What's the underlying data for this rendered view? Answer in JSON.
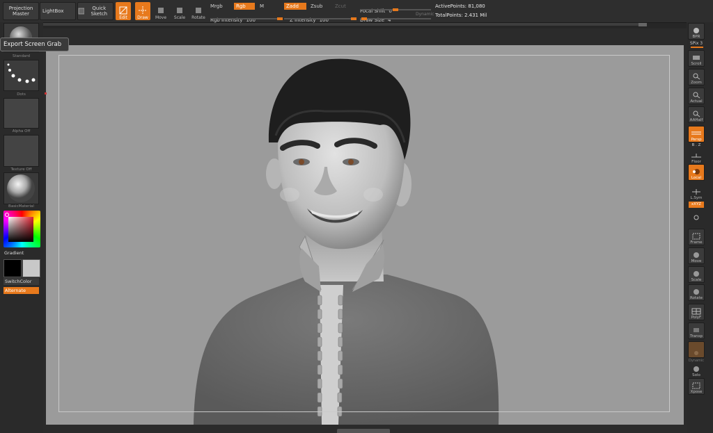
{
  "toolbar": {
    "projection_master": "Projection Master",
    "lightbox": "LightBox",
    "quick_sketch": "Quick Sketch",
    "tools": [
      {
        "label": "Edit",
        "icon": "edit-icon",
        "active": true
      },
      {
        "label": "Draw",
        "icon": "draw-icon",
        "active": true
      },
      {
        "label": "Move",
        "icon": "move-icon",
        "active": false
      },
      {
        "label": "Scale",
        "icon": "scale-icon",
        "active": false
      },
      {
        "label": "Rotate",
        "icon": "rotate-icon",
        "active": false
      }
    ],
    "mrgb": "Mrgb",
    "rgb": "Rgb",
    "m": "M",
    "rgb_intensity_label": "Rgb Intensity",
    "rgb_intensity_value": "100",
    "zadd": "Zadd",
    "zsub": "Zsub",
    "zcut": "Zcut",
    "z_intensity_label": "Z Intensity",
    "z_intensity_value": "100",
    "focal_shift_label": "Focal Shift",
    "focal_shift_value": "0",
    "draw_size_label": "Draw Size",
    "draw_size_value": "4",
    "dynamic": "Dynamic",
    "active_points": "ActivePoints: 81,080",
    "total_points": "TotalPoints: 2.431 Mil"
  },
  "tooltip": "Export Screen Grab",
  "left_shelf": {
    "brush_label": "Standard",
    "stroke_label": "Dots",
    "alpha_label": "Alpha Off",
    "texture_label": "Texture Off",
    "material_label": "BasicMaterial",
    "gradient_label": "Gradient",
    "switch_color_label": "SwitchColor",
    "alternate_label": "Alternate"
  },
  "right_shelf": {
    "items": [
      {
        "label": "BPR",
        "icon": "bpr-icon",
        "state": "normal"
      },
      {
        "label": "Scroll",
        "icon": "scroll-icon",
        "state": "normal"
      },
      {
        "label": "Zoom",
        "icon": "zoom-icon",
        "state": "normal"
      },
      {
        "label": "Actual",
        "icon": "actual-icon",
        "state": "normal"
      },
      {
        "label": "AAHalf",
        "icon": "aahalf-icon",
        "state": "normal"
      },
      {
        "label": "Persp",
        "icon": "persp-icon",
        "state": "on"
      },
      {
        "label": "Floor",
        "icon": "floor-icon",
        "state": "normal"
      },
      {
        "label": "Local",
        "icon": "local-icon",
        "state": "on"
      },
      {
        "label": "L.Sym",
        "icon": "lsym-icon",
        "state": "normal"
      },
      {
        "label": "Frame",
        "icon": "frame-icon",
        "state": "normal"
      },
      {
        "label": "Move",
        "icon": "move-icon",
        "state": "normal"
      },
      {
        "label": "Scale",
        "icon": "scale-icon",
        "state": "normal"
      },
      {
        "label": "Rotate",
        "icon": "rotate-icon",
        "state": "normal"
      },
      {
        "label": "PolyF",
        "icon": "polyf-icon",
        "state": "normal"
      },
      {
        "label": "Transp",
        "icon": "transp-icon",
        "state": "normal"
      },
      {
        "label": "Dynamic",
        "icon": "dynamic-icon",
        "state": "dim"
      },
      {
        "label": "Solo",
        "icon": "solo-icon",
        "state": "normal"
      },
      {
        "label": "Xpose",
        "icon": "xpose-icon",
        "state": "normal"
      }
    ],
    "spix_label": "SPix 3",
    "xyz_label": "xXYZ",
    "floor_extra": "B . Z"
  },
  "colors": {
    "accent": "#e7791c",
    "canvas": "#9b9b9b",
    "panel": "#2a2a2a"
  }
}
